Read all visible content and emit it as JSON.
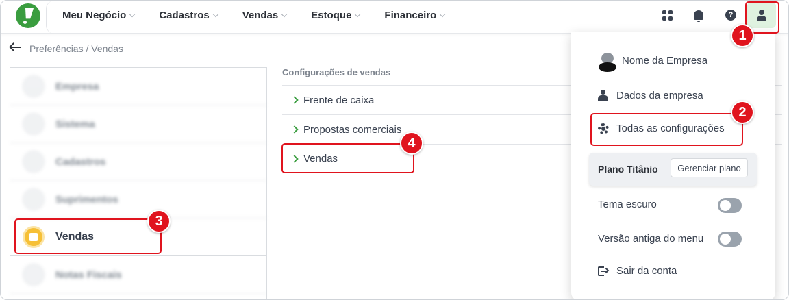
{
  "header": {
    "nav": [
      {
        "label": "Meu Negócio"
      },
      {
        "label": "Cadastros"
      },
      {
        "label": "Vendas"
      },
      {
        "label": "Estoque"
      },
      {
        "label": "Financeiro"
      }
    ],
    "icons": [
      "apps-icon",
      "bell-icon",
      "help-icon",
      "user-icon"
    ]
  },
  "breadcrumb": {
    "text": "Preferências / Vendas"
  },
  "left_menu": {
    "items": [
      {
        "label": "Empresa"
      },
      {
        "label": "Sistema"
      },
      {
        "label": "Cadastros"
      },
      {
        "label": "Suprimentos"
      },
      {
        "label": "Vendas",
        "selected": true
      },
      {
        "label": "Notas Fiscais"
      }
    ]
  },
  "settings": {
    "heading": "Configurações de vendas",
    "rows": [
      {
        "label": "Frente de caixa"
      },
      {
        "label": "Propostas comerciais"
      },
      {
        "label": "Vendas"
      }
    ]
  },
  "user_menu": {
    "company_name": "Nome da Empresa",
    "company_data": "Dados da empresa",
    "all_settings": "Todas as configurações",
    "plan_name": "Plano Titânio",
    "manage_plan": "Gerenciar plano",
    "dark_theme": "Tema escuro",
    "dark_theme_on": false,
    "old_menu": "Versão antiga do menu",
    "old_menu_on": false,
    "logout": "Sair da conta"
  },
  "annotations": {
    "badges": [
      "1",
      "2",
      "3",
      "4"
    ],
    "highlight_color": "#e0141e"
  },
  "colors": {
    "brand_green": "#3a9d3f",
    "vendas_yellow": "#f6c037"
  }
}
